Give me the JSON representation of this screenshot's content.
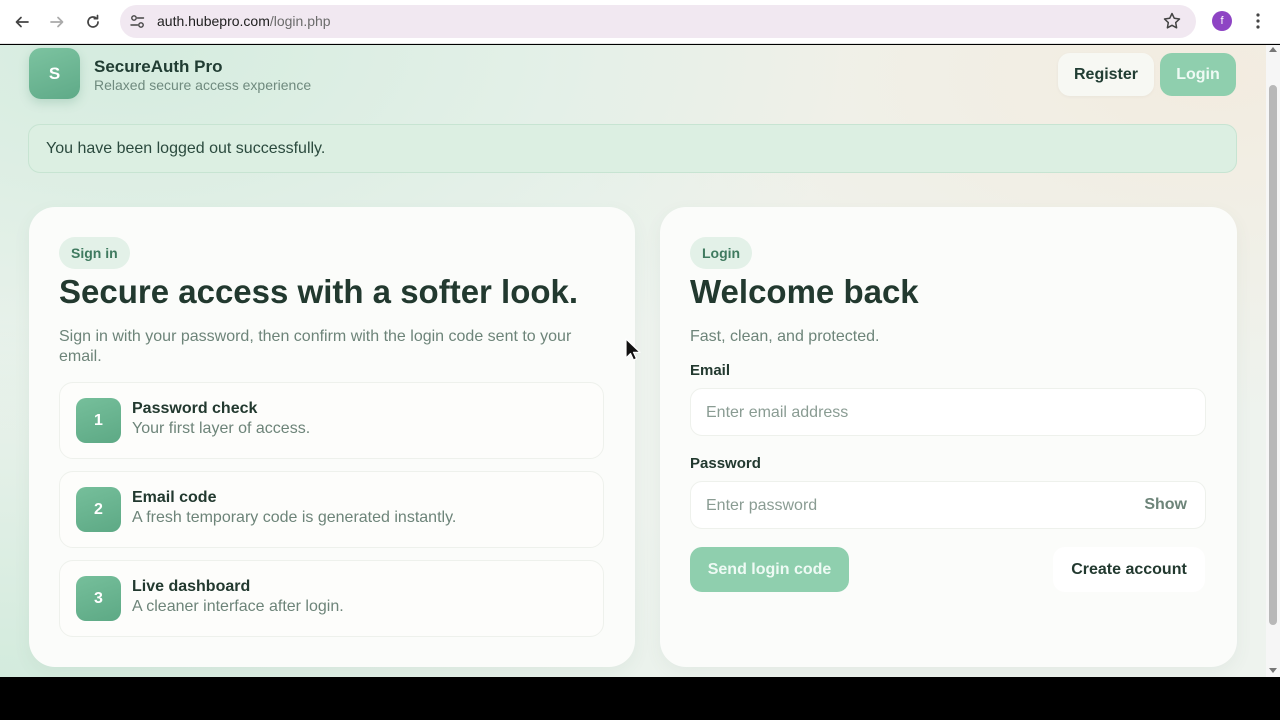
{
  "browser": {
    "url_host": "auth.hubepro.com",
    "url_path": "/login.php",
    "profile_initial": "f"
  },
  "header": {
    "logo_letter": "S",
    "brand_title": "SecureAuth Pro",
    "brand_subtitle": "Relaxed secure access experience",
    "register_label": "Register",
    "login_label": "Login"
  },
  "alert": {
    "message": "You have been logged out successfully."
  },
  "info_card": {
    "chip": "Sign in",
    "heading": "Secure access with a softer look.",
    "lead": "Sign in with your password, then confirm with the login code sent to your email.",
    "steps": [
      {
        "num": "1",
        "title": "Password check",
        "desc": "Your first layer of access."
      },
      {
        "num": "2",
        "title": "Email code",
        "desc": "A fresh temporary code is generated instantly."
      },
      {
        "num": "3",
        "title": "Live dashboard",
        "desc": "A cleaner interface after login."
      }
    ]
  },
  "login_card": {
    "chip": "Login",
    "heading": "Welcome back",
    "lead": "Fast, clean, and protected.",
    "email_label": "Email",
    "email_placeholder": "Enter email address",
    "password_label": "Password",
    "password_placeholder": "Enter password",
    "show_label": "Show",
    "send_label": "Send login code",
    "create_label": "Create account"
  },
  "colors": {
    "accent": "#8fcfae",
    "accent_dark": "#5faa88",
    "text_dark": "#22392f",
    "text_muted": "#6d8479"
  }
}
